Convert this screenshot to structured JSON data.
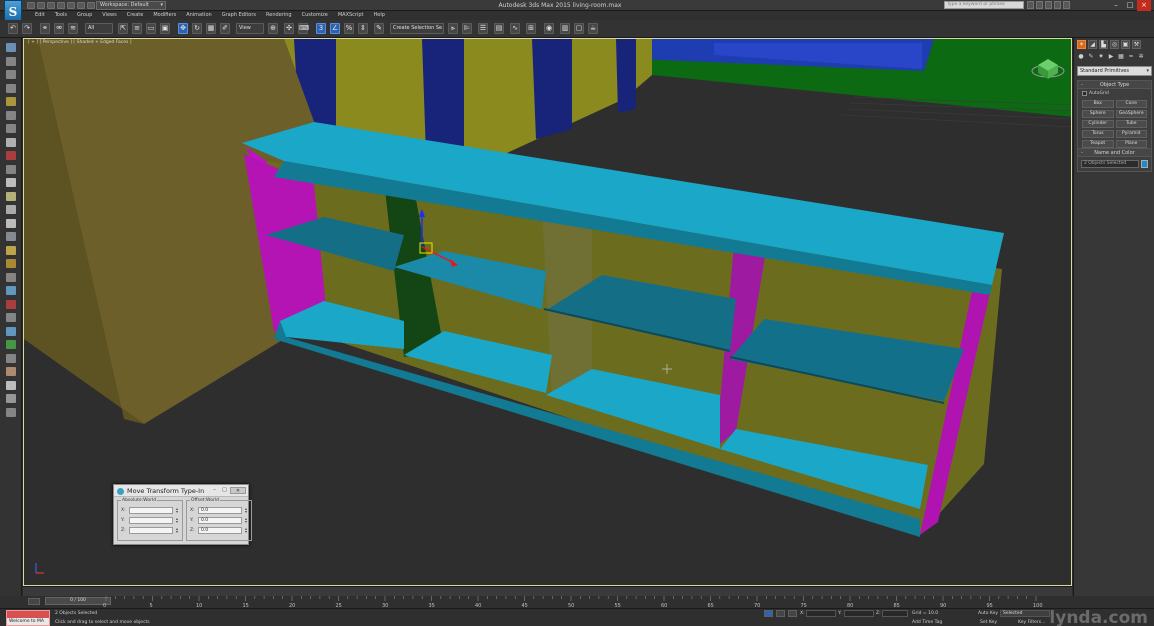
{
  "titlebar": {
    "workspace": "Workspace: Default",
    "title": "Autodesk 3ds Max 2015    living-room.max",
    "search_placeholder": "Type a keyword or phrase"
  },
  "menu": [
    "Edit",
    "Tools",
    "Group",
    "Views",
    "Create",
    "Modifiers",
    "Animation",
    "Graph Editors",
    "Rendering",
    "Customize",
    "MAXScript",
    "Help"
  ],
  "toolbar": {
    "filter_dropdown": "All",
    "coord_dropdown": "View",
    "selection_set": "Create Selection Se"
  },
  "viewport": {
    "label": "[ + ] [ Perspective ] [ Shaded + Edged Faces ]"
  },
  "command_panel": {
    "category": "Standard Primitives",
    "object_type_title": "Object Type",
    "autogrid": "AutoGrid",
    "objects": [
      "Box",
      "Cone",
      "Sphere",
      "GeoSphere",
      "Cylinder",
      "Tube",
      "Torus",
      "Pyramid",
      "Teapot",
      "Plane"
    ],
    "name_color_title": "Name and Color",
    "name_value": "2 Objects Selected",
    "color": "#1b8ecb"
  },
  "transform_dialog": {
    "title": "Move Transform Type-In",
    "absolute_title": "Absolute:World",
    "offset_title": "Offset:World",
    "axes": [
      "X:",
      "Y:",
      "Z:"
    ],
    "absolute_values": [
      "",
      "",
      ""
    ],
    "offset_values": [
      "0.0",
      "0.0",
      "0.0"
    ]
  },
  "timeline": {
    "frame": "0 / 100",
    "ticks": [
      "0",
      "5",
      "10",
      "15",
      "20",
      "25",
      "30",
      "35",
      "40",
      "45",
      "50",
      "55",
      "60",
      "65",
      "70",
      "75",
      "80",
      "85",
      "90",
      "95",
      "100"
    ]
  },
  "status": {
    "maxscript": "Welcome to MA",
    "selected": "2 Objects Selected",
    "prompt": "Click and drag to select and move objects",
    "x_label": "X:",
    "y_label": "Y:",
    "z_label": "Z:",
    "grid": "Grid = 10.0",
    "add_time_tag": "Add Time Tag",
    "auto_key": "Auto Key",
    "auto_key_value": "Selected",
    "set_key": "Set Key",
    "key_filters": "Key Filters...",
    "watermark": "lynda.com"
  }
}
